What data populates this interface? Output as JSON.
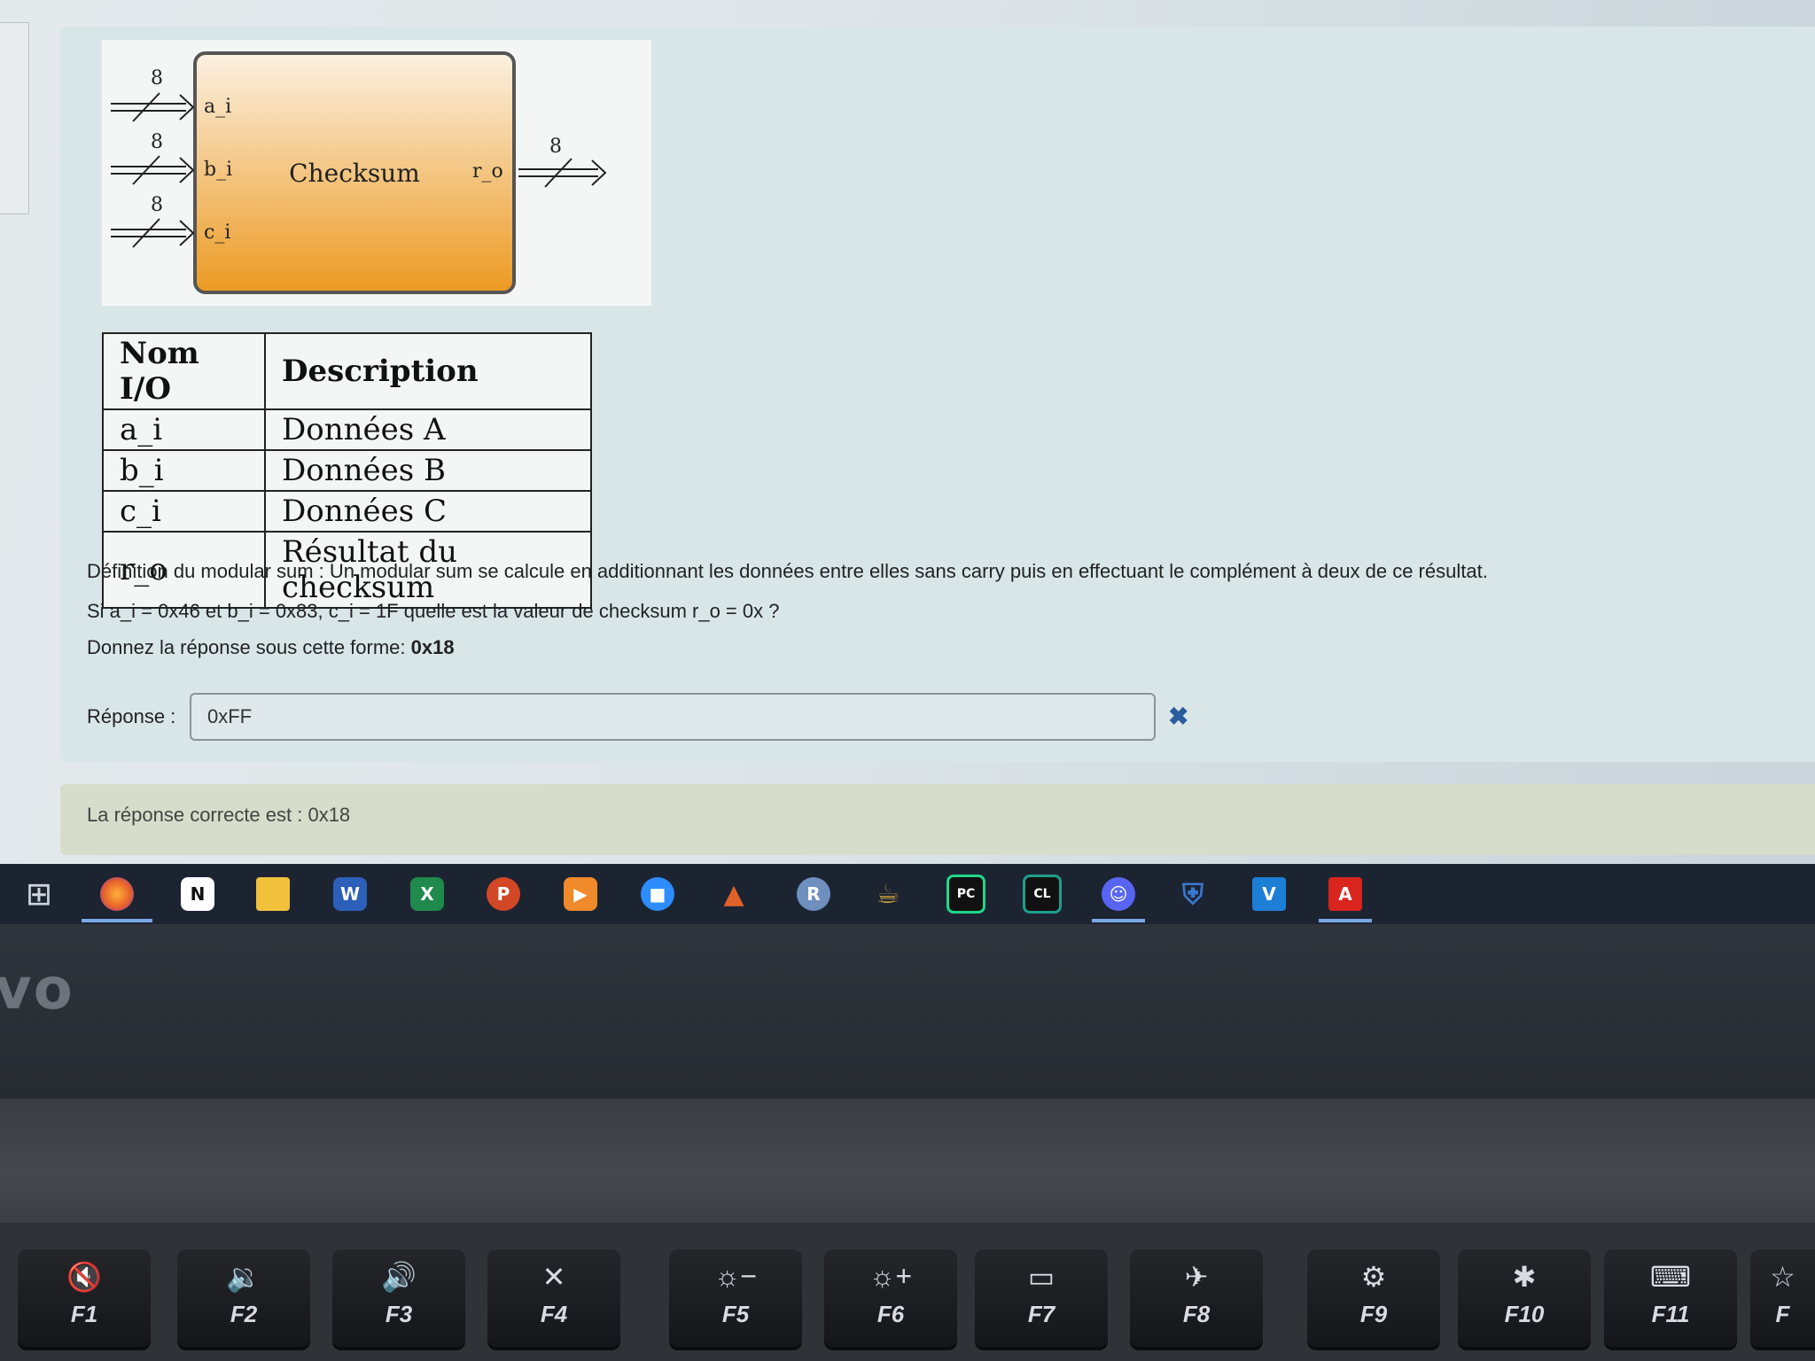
{
  "diagram": {
    "block_label": "Checksum",
    "inputs": [
      {
        "name": "a_i",
        "width": "8"
      },
      {
        "name": "b_i",
        "width": "8"
      },
      {
        "name": "c_i",
        "width": "8"
      }
    ],
    "output": {
      "name": "r_o",
      "width": "8"
    }
  },
  "io_table": {
    "headers": [
      "Nom I/O",
      "Description"
    ],
    "rows": [
      {
        "name": "a_i",
        "desc": "Données A"
      },
      {
        "name": "b_i",
        "desc": "Données B"
      },
      {
        "name": "c_i",
        "desc": "Données C"
      },
      {
        "name": "r_o",
        "desc": "Résultat du checksum"
      }
    ]
  },
  "question": {
    "definition": "Définition du modular sum :  Un modular sum se calcule en additionnant les données entre elles sans carry puis en effectuant le complément à deux de ce résultat.",
    "prompt": "Si a_i = 0x46 et b_i = 0x83, c_i = 1F quelle est la valeur de checksum r_o = 0x ?",
    "format_prefix": "Donnez la réponse sous cette forme: ",
    "format_example": "0x18"
  },
  "answer": {
    "label": "Réponse :",
    "value": "0xFF",
    "status_icon": "wrong-cross-icon"
  },
  "feedback": {
    "text": "La réponse correcte est : 0x18"
  },
  "taskbar": {
    "items": [
      {
        "name": "task-view",
        "glyph": "⊞",
        "color": "#1c2432"
      },
      {
        "name": "firefox",
        "glyph": "●",
        "color": "#e8632b"
      },
      {
        "name": "notion",
        "glyph": "N",
        "color": "#ffffff"
      },
      {
        "name": "file-explorer",
        "glyph": "▬",
        "color": "#f2c13c"
      },
      {
        "name": "word",
        "glyph": "W",
        "color": "#2b5fb8"
      },
      {
        "name": "excel",
        "glyph": "X",
        "color": "#1f8a4c"
      },
      {
        "name": "powerpoint",
        "glyph": "P",
        "color": "#d24726"
      },
      {
        "name": "media-player",
        "glyph": "▶",
        "color": "#f08a2a"
      },
      {
        "name": "zoom",
        "glyph": "■",
        "color": "#2d8cff"
      },
      {
        "name": "matlab",
        "glyph": "▲",
        "color": "#e0622a"
      },
      {
        "name": "r-app",
        "glyph": "R",
        "color": "#6f8fbf"
      },
      {
        "name": "jupyter",
        "glyph": "☕",
        "color": "#c79a3c"
      },
      {
        "name": "pycharm",
        "glyph": "PC",
        "color": "#21d789"
      },
      {
        "name": "clion",
        "glyph": "CL",
        "color": "#1e9e8e"
      },
      {
        "name": "discord",
        "glyph": "☺",
        "color": "#5865f2"
      },
      {
        "name": "security",
        "glyph": "⛨",
        "color": "#3a78d0"
      },
      {
        "name": "vscode-insiders",
        "glyph": "V",
        "color": "#1d7ed6"
      },
      {
        "name": "acrobat",
        "glyph": "A",
        "color": "#d9251d"
      }
    ]
  },
  "laptop": {
    "brand_text": "vo",
    "fkeys": [
      {
        "label": "F1",
        "symbol": "🔇"
      },
      {
        "label": "F2",
        "symbol": "🔉"
      },
      {
        "label": "F3",
        "symbol": "🔊"
      },
      {
        "label": "F4",
        "symbol": "✕"
      },
      {
        "label": "F5",
        "symbol": "☼−"
      },
      {
        "label": "F6",
        "symbol": "☼+"
      },
      {
        "label": "F7",
        "symbol": "▭"
      },
      {
        "label": "F8",
        "symbol": "✈"
      },
      {
        "label": "F9",
        "symbol": "⚙"
      },
      {
        "label": "F10",
        "symbol": "✱"
      },
      {
        "label": "F11",
        "symbol": "⌨"
      },
      {
        "label": "F",
        "symbol": "☆"
      }
    ]
  }
}
